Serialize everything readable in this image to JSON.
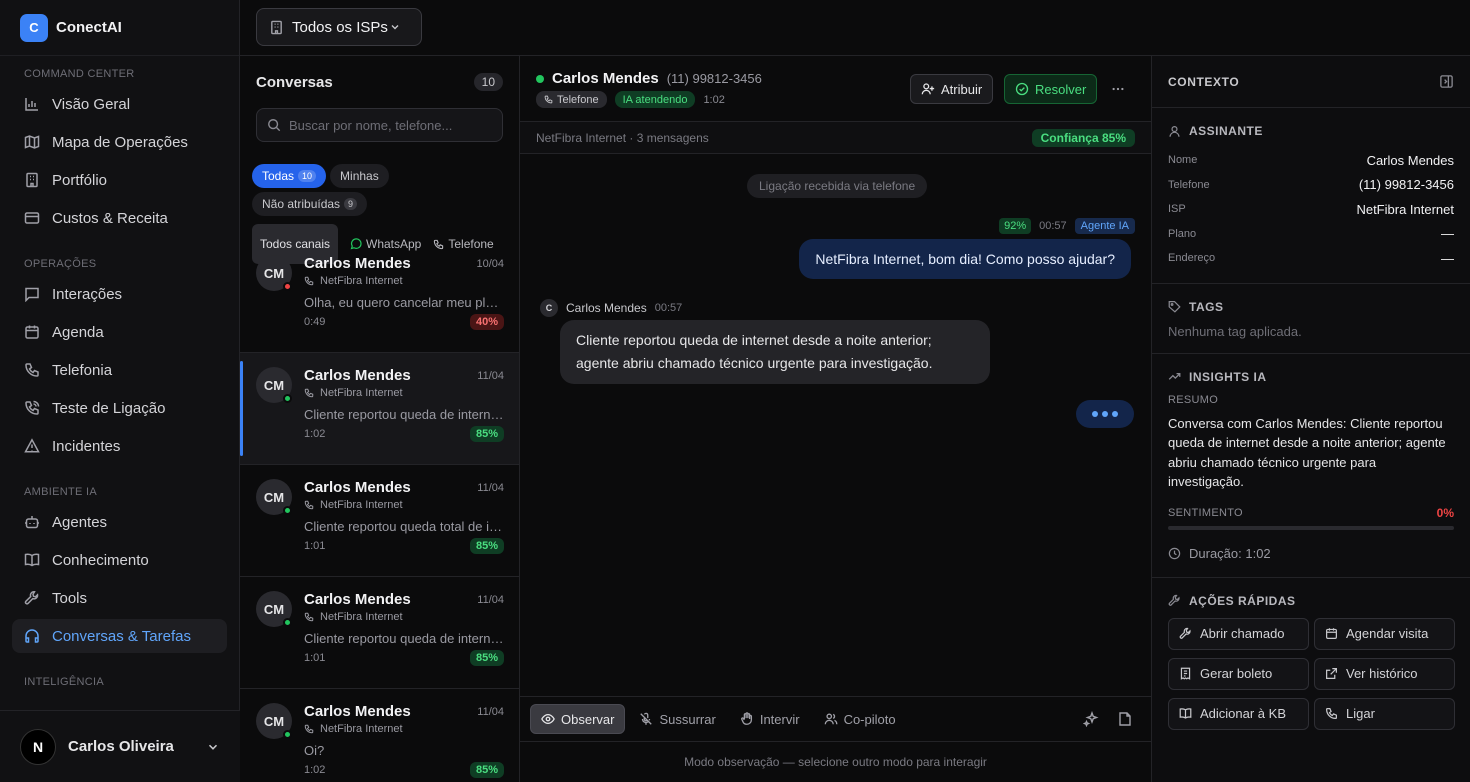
{
  "brand": {
    "logo_letter": "C",
    "name": "ConectAI"
  },
  "sidebar": {
    "sections": [
      {
        "title": "COMMAND CENTER",
        "items": [
          {
            "label": "Visão Geral",
            "icon": "bar-chart-icon"
          },
          {
            "label": "Mapa de Operações",
            "icon": "map-icon"
          },
          {
            "label": "Portfólio",
            "icon": "building-icon"
          },
          {
            "label": "Custos & Receita",
            "icon": "credit-card-icon"
          }
        ]
      },
      {
        "title": "OPERAÇÕES",
        "items": [
          {
            "label": "Interações",
            "icon": "message-square-icon"
          },
          {
            "label": "Agenda",
            "icon": "calendar-icon"
          },
          {
            "label": "Telefonia",
            "icon": "phone-icon"
          },
          {
            "label": "Teste de Ligação",
            "icon": "phone-call-icon"
          },
          {
            "label": "Incidentes",
            "icon": "alert-triangle-icon"
          }
        ]
      },
      {
        "title": "AMBIENTE IA",
        "items": [
          {
            "label": "Agentes",
            "icon": "bot-icon"
          },
          {
            "label": "Conhecimento",
            "icon": "book-icon"
          },
          {
            "label": "Tools",
            "icon": "wrench-icon"
          },
          {
            "label": "Conversas & Tarefas",
            "icon": "headphones-icon",
            "active": true
          }
        ]
      },
      {
        "title": "INTELIGÊNCIA",
        "items": []
      }
    ],
    "user": {
      "initial": "N",
      "name": "Carlos Oliveira"
    }
  },
  "topbar": {
    "isp_select": "Todos os ISPs"
  },
  "conversations": {
    "title": "Conversas",
    "count": "10",
    "search_placeholder": "Buscar por nome, telefone...",
    "filters": {
      "all": "Todas",
      "all_count": "10",
      "mine": "Minhas",
      "unassigned": "Não atribuídas",
      "unassigned_count": "9"
    },
    "channels": {
      "all": "Todos canais",
      "whatsapp": "WhatsApp",
      "phone": "Telefone"
    },
    "items": [
      {
        "initials": "CM",
        "name": "Carlos Mendes",
        "date": "10/04",
        "isp": "NetFibra Internet",
        "message": "Olha, eu quero cancelar meu plano",
        "duration": "0:49",
        "confidence": "40%",
        "level": "red",
        "status": "red"
      },
      {
        "initials": "CM",
        "name": "Carlos Mendes",
        "date": "11/04",
        "isp": "NetFibra Internet",
        "message": "Cliente reportou queda de internet desde a noite anterior",
        "duration": "1:02",
        "confidence": "85%",
        "level": "green",
        "status": "green",
        "selected": true
      },
      {
        "initials": "CM",
        "name": "Carlos Mendes",
        "date": "11/04",
        "isp": "NetFibra Internet",
        "message": "Cliente reportou queda total de internet",
        "duration": "1:01",
        "confidence": "85%",
        "level": "green",
        "status": "green"
      },
      {
        "initials": "CM",
        "name": "Carlos Mendes",
        "date": "11/04",
        "isp": "NetFibra Internet",
        "message": "Cliente reportou queda de internet desde a noite anterior",
        "duration": "1:01",
        "confidence": "85%",
        "level": "green",
        "status": "green"
      },
      {
        "initials": "CM",
        "name": "Carlos Mendes",
        "date": "11/04",
        "isp": "NetFibra Internet",
        "message": "Oi?",
        "duration": "1:02",
        "confidence": "85%",
        "level": "green",
        "status": "green"
      }
    ]
  },
  "chat": {
    "name": "Carlos Mendes",
    "phone": "(11) 99812-3456",
    "tag_channel": "Telefone",
    "tag_status": "IA atendendo",
    "duration": "1:02",
    "assign_label": "Atribuir",
    "resolve_label": "Resolver",
    "subheader": "NetFibra Internet · 3 mensagens",
    "confidence": "Confiança 85%",
    "system_message": "Ligação recebida via telefone",
    "agent_msg": {
      "confidence": "92%",
      "time": "00:57",
      "badge": "Agente IA",
      "text": "NetFibra Internet, bom dia! Como posso ajudar?"
    },
    "client_msg": {
      "initial": "C",
      "name": "Carlos Mendes",
      "time": "00:57",
      "text": "Cliente reportou queda de internet desde a noite anterior; agente abriu chamado técnico urgente para investigação."
    },
    "modes": [
      "Observar",
      "Sussurrar",
      "Intervir",
      "Co-piloto"
    ],
    "mode_hint": "Modo observação — selecione outro modo para interagir"
  },
  "context": {
    "title": "CONTEXTO",
    "subscriber": {
      "title": "ASSINANTE",
      "fields": [
        {
          "k": "Nome",
          "v": "Carlos Mendes"
        },
        {
          "k": "Telefone",
          "v": "(11) 99812-3456"
        },
        {
          "k": "ISP",
          "v": "NetFibra Internet"
        },
        {
          "k": "Plano",
          "v": "—"
        },
        {
          "k": "Endereço",
          "v": "—"
        }
      ]
    },
    "tags": {
      "title": "TAGS",
      "empty": "Nenhuma tag aplicada."
    },
    "insights": {
      "title": "INSIGHTS IA",
      "summary_label": "RESUMO",
      "summary": "Conversa com Carlos Mendes: Cliente reportou queda de internet desde a noite anterior; agente abriu chamado técnico urgente para investigação.",
      "sentiment_label": "SENTIMENTO",
      "sentiment": "0%",
      "sentiment_fraction": 0,
      "duration": "Duração: 1:02"
    },
    "quick_actions": {
      "title": "AÇÕES RÁPIDAS",
      "items": [
        "Abrir chamado",
        "Agendar visita",
        "Gerar boleto",
        "Ver histórico",
        "Adicionar à KB",
        "Ligar"
      ]
    }
  },
  "colors": {
    "accent": "#3b82f6",
    "success": "#22c55e",
    "danger": "#ef4444"
  }
}
